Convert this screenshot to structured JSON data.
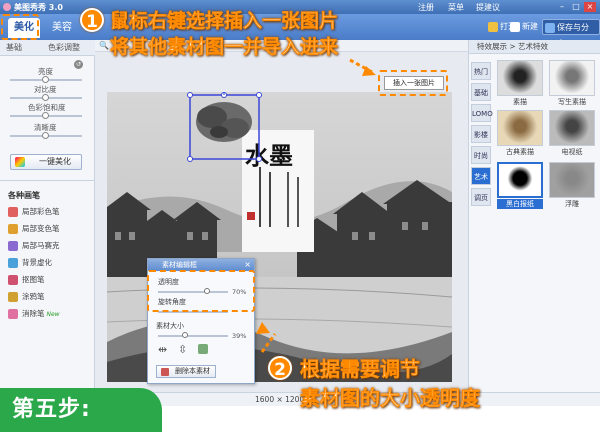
{
  "window": {
    "title": "美图秀秀 3.0",
    "menu": [
      "注册",
      "菜单",
      "提建议"
    ]
  },
  "ribbon": {
    "tabs": [
      "美化",
      "美容"
    ],
    "open_label": "打开",
    "new_label": "新建",
    "save_label": "保存与分享"
  },
  "left_panel": {
    "sub_tabs": [
      "基础",
      "色彩调整"
    ],
    "sliders": [
      {
        "label": "亮度",
        "value": 0.5
      },
      {
        "label": "对比度",
        "value": 0.5
      },
      {
        "label": "色彩饱和度",
        "value": 0.5
      },
      {
        "label": "清晰度",
        "value": 0.5
      }
    ],
    "one_click_label": "一键美化",
    "brushes_title": "各种画笔",
    "brushes": [
      {
        "label": "局部彩色笔",
        "color": "#e06060"
      },
      {
        "label": "局部变色笔",
        "color": "#e0a030"
      },
      {
        "label": "局部马赛克",
        "color": "#8a6ad0"
      },
      {
        "label": "背景虚化",
        "color": "#4aa0d8"
      },
      {
        "label": "抠图笔",
        "color": "#d05070"
      },
      {
        "label": "涂鸦笔",
        "color": "#d0a030"
      },
      {
        "label": "消除笔",
        "color": "#e070a0",
        "badge": "New"
      }
    ]
  },
  "canvas": {
    "watermark_title": "水墨",
    "status": "1600 × 1200"
  },
  "insert_button": "插入一张图片",
  "right_panel": {
    "header": "特效展示 > 艺术特效",
    "categories": [
      "热门",
      "基础",
      "LOMO",
      "影楼",
      "时尚",
      "艺术",
      "调页"
    ],
    "active_category": "艺术",
    "effects": [
      {
        "label": "素描"
      },
      {
        "label": "写生素描"
      },
      {
        "label": "古典素描"
      },
      {
        "label": "电视纸"
      },
      {
        "label": "黑白报纸"
      },
      {
        "label": "浮雕"
      }
    ],
    "selected_effect": "黑白报纸"
  },
  "dialog": {
    "title": "素材编辑框",
    "opacity_label": "透明度",
    "opacity_value": "70%",
    "opacity": 0.7,
    "rotation_label": "旋转角度",
    "size_label": "素材大小",
    "size_value": "39%",
    "size": 0.39,
    "delete_label": "删除本素材"
  },
  "annotations": {
    "step1_number": "1",
    "step1_line1": "鼠标右键选择插入一张图片",
    "step1_line2": "将其他素材图一并导入进来",
    "step2_number": "2",
    "step2_line1": "根据需要调节",
    "step2_line2": "素材图的大小透明度",
    "step_badge": "第五步:"
  },
  "colors": {
    "accent": "#ff8a00",
    "ribbon": "#4a7cc8",
    "step_badge": "#2ba84a"
  }
}
